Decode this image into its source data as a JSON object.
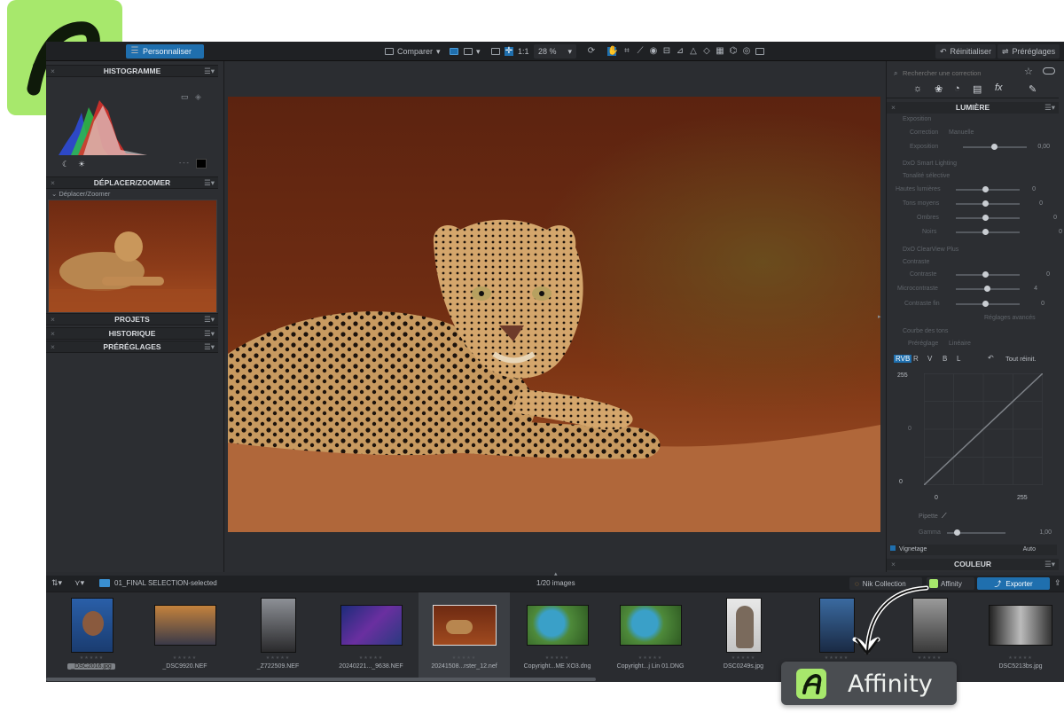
{
  "app": {
    "top_toolbar": {
      "personalize_label": "Personnaliser",
      "compare_label": "Comparer",
      "one_to_one": "1:1",
      "zoom": "28 %",
      "reset_label": "Réinitialiser",
      "presets_label": "Préréglages"
    },
    "left_panel": {
      "histogram_title": "HISTOGRAMME",
      "move_zoom_title": "DÉPLACER/ZOOMER",
      "move_zoom_sub": "Déplacer/Zoomer",
      "projects_title": "PROJETS",
      "history_title": "HISTORIQUE",
      "presets_title": "PRÉRÉGLAGES",
      "histogram_readout": "- - -"
    },
    "right_panel": {
      "search_placeholder": "Rechercher une correction",
      "light_title": "LUMIÈRE",
      "exposure_group": "Exposition",
      "correction_label": "Correction",
      "correction_value": "Manuelle",
      "exposure_label": "Exposition",
      "exposure_value": "0,00",
      "smart_lighting": "DxO Smart Lighting",
      "selective_tone": "Tonalité sélective",
      "highlights": "Hautes lumières",
      "highlights_value": "0",
      "midtones": "Tons moyens",
      "midtones_value": "0",
      "shadows": "Ombres",
      "shadows_value": "0",
      "blacks": "Noirs",
      "blacks_value": "0",
      "clearview": "DxO ClearView Plus",
      "contrast_group": "Contraste",
      "contrast": "Contraste",
      "contrast_value": "0",
      "microcontrast": "Microcontraste",
      "microcontrast_value": "4",
      "fine_contrast": "Contraste fin",
      "fine_contrast_value": "0",
      "advanced_settings": "Réglages avancés",
      "tone_curve": "Courbe des tons",
      "preset_label": "Préréglage",
      "preset_value": "Linéaire",
      "channels": [
        "RVB",
        "R",
        "V",
        "B",
        "L"
      ],
      "reset_all": "Tout réinit.",
      "curve_top": "255",
      "curve_bottom": "0",
      "curve_mid": "0",
      "x_min": "0",
      "x_max": "255",
      "pipette": "Pipette",
      "gamma_label": "Gamma",
      "gamma_value": "1,00",
      "vignetting": "Vignetage",
      "vignetting_value": "Auto",
      "color_title": "COULEUR"
    },
    "bottom_bar": {
      "folder_label": "01_FINAL SELECTION-selected",
      "count_label": "1/20 images",
      "nik_label": "Nik Collection",
      "affinity_label": "Affinity",
      "export_label": "Exporter"
    },
    "filmstrip": [
      {
        "name": "_DSC2016.jpg",
        "selected_label": true
      },
      {
        "name": "_DSC9920.NEF"
      },
      {
        "name": "_Z722509.NEF"
      },
      {
        "name": "20240221..._9638.NEF"
      },
      {
        "name": "20241508...rster_12.nef",
        "active": true
      },
      {
        "name": "Copyright...ME XO3.dng"
      },
      {
        "name": "Copyright...j Lin 01.DNG"
      },
      {
        "name": "DSC0249s.jpg"
      },
      {
        "name": ""
      },
      {
        "name": ""
      },
      {
        "name": "DSC5213bs.jpg"
      }
    ]
  },
  "callout": {
    "label": "Affinity"
  },
  "colors": {
    "accent": "#1f6fae",
    "brand_green": "#a7e86c"
  }
}
